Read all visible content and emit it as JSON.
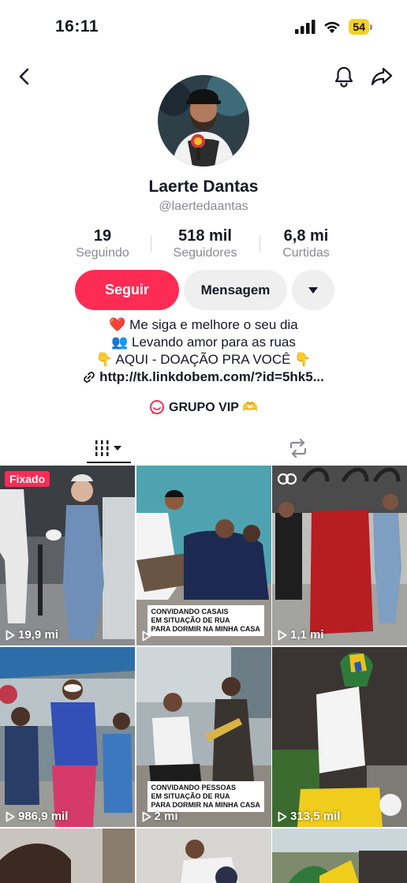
{
  "status_bar": {
    "time": "16:11",
    "battery": "54"
  },
  "profile": {
    "name": "Laerte Dantas",
    "handle": "@laertedaantas",
    "stats": [
      {
        "value": "19",
        "label": "Seguindo"
      },
      {
        "value": "518 mil",
        "label": "Seguidores"
      },
      {
        "value": "6,8 mi",
        "label": "Curtidas"
      }
    ],
    "follow_label": "Seguir",
    "message_label": "Mensagem",
    "bio": [
      "❤️ Me siga e melhore o seu dia",
      "👥 Levando amor para as ruas",
      "👇 AQUI - DOAÇÃO PRA VOCÊ 👇"
    ],
    "link": "http://tk.linkdobem.com/?id=5hk5...",
    "group": "GRUPO VIP 🫶"
  },
  "videos": [
    {
      "views": "19,9 mi",
      "pinned": "Fixado"
    },
    {
      "views": "",
      "caption": [
        "CONVIDANDO CASAIS",
        "EM SITUAÇÃO DE RUA",
        "PARA DORMIR NA MINHA CASA"
      ]
    },
    {
      "views": "1,1 mi"
    },
    {
      "views": "986,9 mil"
    },
    {
      "views": "2 mi",
      "caption": [
        "CONVIDANDO PESSOAS",
        "EM SITUAÇÃO DE RUA",
        "PARA DORMIR NA MINHA CASA"
      ]
    },
    {
      "views": "313,5 mil"
    }
  ],
  "colors": {
    "accent": "#fe2c55",
    "secondary_button": "#efeff0",
    "muted_text": "#8a8b91"
  }
}
